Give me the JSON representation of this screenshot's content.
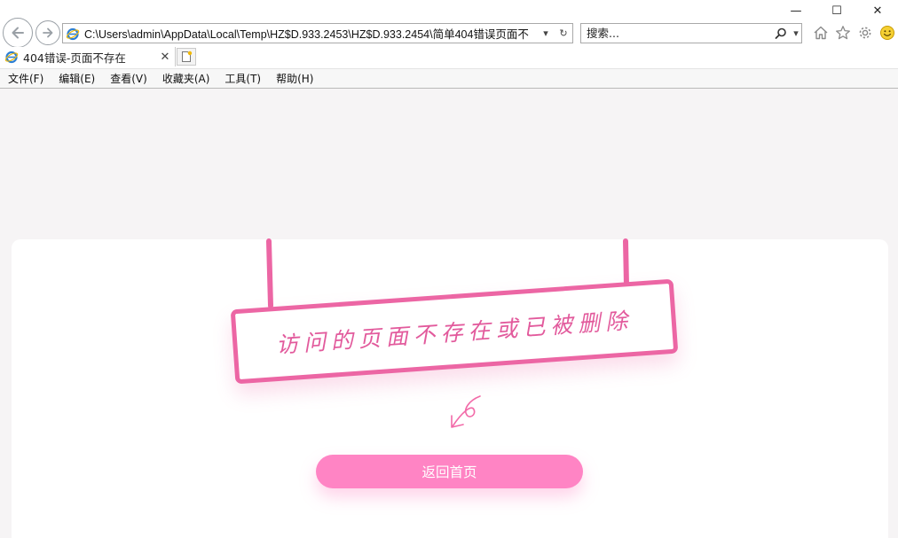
{
  "window": {
    "minimize_glyph": "—",
    "maximize_glyph": "☐",
    "close_glyph": "✕"
  },
  "address_bar": {
    "url": "C:\\Users\\admin\\AppData\\Local\\Temp\\HZ$D.933.2453\\HZ$D.933.2454\\简单404错误页面不",
    "dropdown_glyph": "▾",
    "refresh_glyph": "↻"
  },
  "search": {
    "placeholder": "搜索...",
    "dropdown_glyph": "▾"
  },
  "tab": {
    "title": "404错误-页面不存在",
    "close_glyph": "✕"
  },
  "menu": {
    "items": [
      "文件(F)",
      "编辑(E)",
      "查看(V)",
      "收藏夹(A)",
      "工具(T)",
      "帮助(H)"
    ]
  },
  "page": {
    "sign_text": "访问的页面不存在或已被删除",
    "home_button": "返回首页"
  },
  "colors": {
    "accent": "#ec66a4",
    "button": "#ff84c4",
    "page_bg": "#f6f4f5",
    "card_bg": "#ffffff"
  },
  "icons": [
    "back-arrow-icon",
    "forward-arrow-icon",
    "ie-logo-icon",
    "search-icon",
    "home-icon",
    "star-icon",
    "gear-icon",
    "smiley-icon",
    "new-tab-icon",
    "arrow-down-left-icon"
  ]
}
